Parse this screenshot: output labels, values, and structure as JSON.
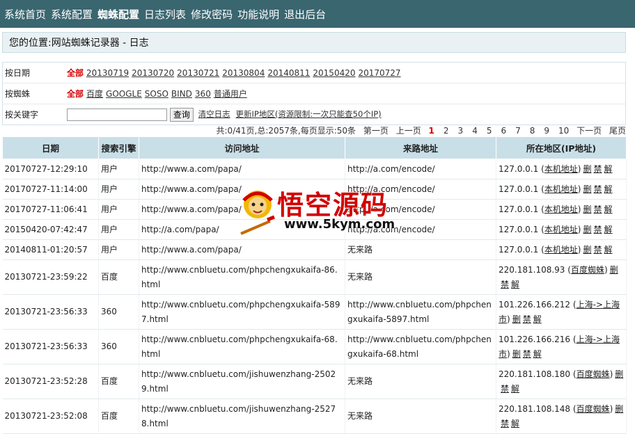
{
  "nav": [
    "系统首页",
    "系统配置",
    "蜘蛛配置",
    "日志列表",
    "修改密码",
    "功能说明",
    "退出后台"
  ],
  "location": "您的位置:网站蜘蛛记录器 - 日志",
  "filters": {
    "date_label": "按日期",
    "date_options": [
      "全部",
      "20130719",
      "20130720",
      "20130721",
      "20130804",
      "20140811",
      "20150420",
      "20170727"
    ],
    "spider_label": "按蜘蛛",
    "spider_options": [
      "全部",
      "百度",
      "GOOGLE",
      "SOSO",
      "BIND",
      "360",
      "普通用户"
    ],
    "keyword_label": "按关键字",
    "keyword_value": "",
    "query_button": "查询",
    "clear_log": "清空日志",
    "update_ip": "更新IP地区(资源限制:一次只能查50个IP)"
  },
  "pager": {
    "summary": "共:0/41页,总:2057条,每页显示:50条",
    "first": "第一页",
    "prev": "上一页",
    "pages": [
      "1",
      "2",
      "3",
      "4",
      "5",
      "6",
      "7",
      "8",
      "9",
      "10"
    ],
    "current": "1",
    "next": "下一页",
    "last": "尾页"
  },
  "table": {
    "headers": [
      "日期",
      "搜索引擎",
      "访问地址",
      "来路地址",
      "所在地区(IP地址)"
    ],
    "actions": [
      "删",
      "禁",
      "解"
    ],
    "rows": [
      {
        "date": "20170727-12:29:10",
        "engine": "用户",
        "url": "http://www.a.com/papa/",
        "referrer": "http://a.com/encode/",
        "ip": "127.0.0.1",
        "region": "本机地址"
      },
      {
        "date": "20170727-11:14:00",
        "engine": "用户",
        "url": "http://www.a.com/papa/",
        "referrer": "http://a.com/encode/",
        "ip": "127.0.0.1",
        "region": "本机地址"
      },
      {
        "date": "20170727-11:06:41",
        "engine": "用户",
        "url": "http://www.a.com/papa/",
        "referrer": "http://a.com/encode/",
        "ip": "127.0.0.1",
        "region": "本机地址"
      },
      {
        "date": "20150420-07:42:47",
        "engine": "用户",
        "url": "http://a.com/papa/",
        "referrer": "http://a.com/encode/",
        "ip": "127.0.0.1",
        "region": "本机地址"
      },
      {
        "date": "20140811-01:20:57",
        "engine": "用户",
        "url": "http://www.a.com/papa/",
        "referrer": "无来路",
        "ip": "127.0.0.1",
        "region": "本机地址"
      },
      {
        "date": "20130721-23:59:22",
        "engine": "百度",
        "url": "http://www.cnbluetu.com/phpchengxukaifa-86.html",
        "referrer": "无来路",
        "ip": "220.181.108.93",
        "region": "百度蜘蛛"
      },
      {
        "date": "20130721-23:56:33",
        "engine": "360",
        "url": "http://www.cnbluetu.com/phpchengxukaifa-5897.html",
        "referrer": "http://www.cnbluetu.com/phpchengxukaifa-5897.html",
        "ip": "101.226.166.212",
        "region": "上海->上海市"
      },
      {
        "date": "20130721-23:56:33",
        "engine": "360",
        "url": "http://www.cnbluetu.com/phpchengxukaifa-68.html",
        "referrer": "http://www.cnbluetu.com/phpchengxukaifa-68.html",
        "ip": "101.226.166.216",
        "region": "上海->上海市"
      },
      {
        "date": "20130721-23:52:28",
        "engine": "百度",
        "url": "http://www.cnbluetu.com/jishuwenzhang-25029.html",
        "referrer": "无来路",
        "ip": "220.181.108.180",
        "region": "百度蜘蛛"
      },
      {
        "date": "20130721-23:52:08",
        "engine": "百度",
        "url": "http://www.cnbluetu.com/jishuwenzhang-25278.html",
        "referrer": "无来路",
        "ip": "220.181.108.148",
        "region": "百度蜘蛛"
      }
    ]
  },
  "watermark": {
    "title": "悟空源码",
    "url": "www.5kym.com",
    "icon": "monkey-king-logo"
  },
  "colors": {
    "nav_bg": "#3a6670",
    "header_bg": "#c9dfe8",
    "selected": "#d40000",
    "link_red": "#c00000"
  }
}
